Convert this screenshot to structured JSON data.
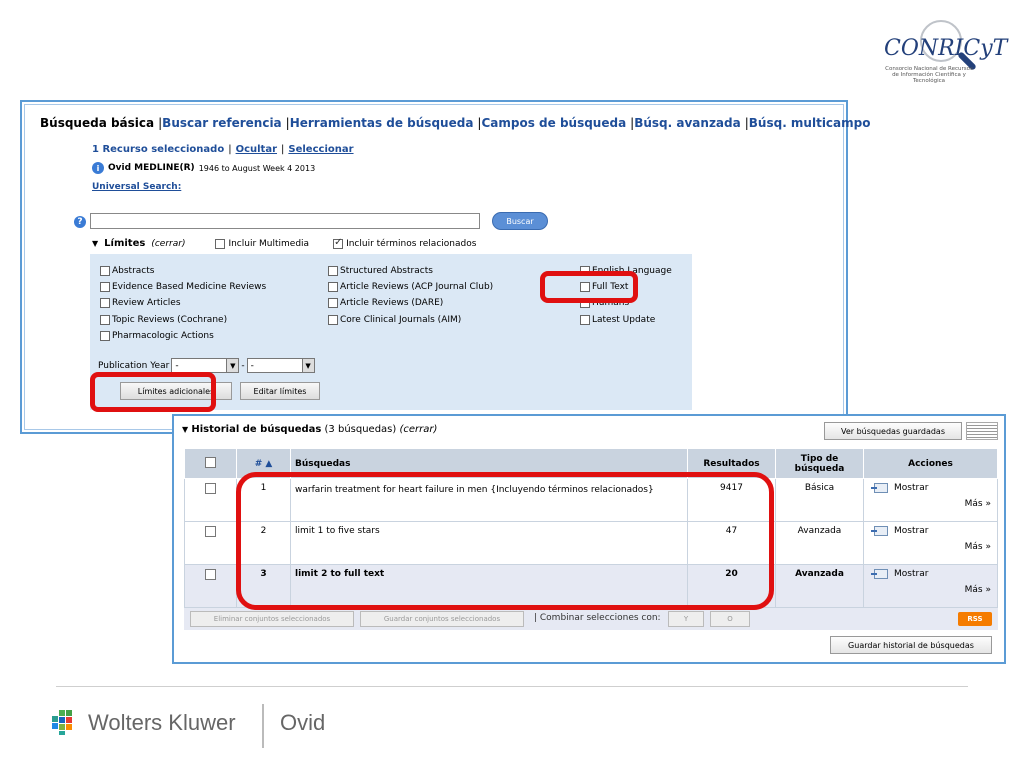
{
  "logo": {
    "name": "CONRICyT",
    "subtitle": "Consorcio Nacional de Recursos de Información Científica y Tecnológica"
  },
  "tabs": [
    {
      "label": "Búsqueda básica",
      "active": true
    },
    {
      "label": "Buscar referencia"
    },
    {
      "label": "Herramientas de búsqueda"
    },
    {
      "label": "Campos de búsqueda"
    },
    {
      "label": "Búsq. avanzada"
    },
    {
      "label": "Búsq. multicampo"
    }
  ],
  "resources": {
    "selected": "1 Recurso seleccionado",
    "hide": "Ocultar",
    "select": "Seleccionar",
    "database": "Ovid MEDLINE(R)",
    "range": "1946 to August Week 4 2013",
    "universal": "Universal Search:"
  },
  "search": {
    "button": "Buscar",
    "value": ""
  },
  "limits": {
    "title": "Límites",
    "close": "(cerrar)",
    "multimedia": "Incluir Multimedia",
    "related": "Incluir términos relacionados",
    "col1": [
      "Abstracts",
      "Evidence Based Medicine Reviews",
      "Review Articles",
      "Topic Reviews (Cochrane)",
      "Pharmacologic Actions"
    ],
    "col2": [
      "Structured Abstracts",
      "Article Reviews (ACP Journal Club)",
      "Article Reviews (DARE)",
      "Core Clinical Journals (AIM)"
    ],
    "col3": [
      "English Language",
      "Full Text",
      "Humans",
      "Latest Update"
    ],
    "pub_year_label": "Publication Year",
    "year_from": "-",
    "year_to": "-",
    "additional": "Límites adicionales",
    "edit": "Editar límites"
  },
  "history": {
    "title": "Historial de búsquedas",
    "count": "(3 búsquedas)",
    "close": "(cerrar)",
    "saved_button": "Ver búsquedas guardadas",
    "columns": {
      "num": "# ▲",
      "query": "Búsquedas",
      "results": "Resultados",
      "type": "Tipo de búsqueda",
      "actions": "Acciones"
    },
    "rows": [
      {
        "num": "1",
        "query": "warfarin treatment for heart failure in men {Incluyendo términos relacionados}",
        "results": "9417",
        "type": "Básica",
        "show": "Mostrar",
        "more": "Más »"
      },
      {
        "num": "2",
        "query": "limit 1 to five stars",
        "results": "47",
        "type": "Avanzada",
        "show": "Mostrar",
        "more": "Más »"
      },
      {
        "num": "3",
        "query": "limit 2 to full text",
        "results": "20",
        "type": "Avanzada",
        "show": "Mostrar",
        "more": "Más »"
      }
    ],
    "delete_btn": "Eliminar conjuntos seleccionados",
    "save_sets_btn": "Guardar conjuntos seleccionados",
    "combine_label": "| Combinar selecciones con:",
    "and_btn": "Y",
    "or_btn": "O",
    "rss": "RSS",
    "save_history_btn": "Guardar historial de búsquedas"
  },
  "footer": {
    "brand": "Wolters Kluwer",
    "product": "Ovid"
  }
}
